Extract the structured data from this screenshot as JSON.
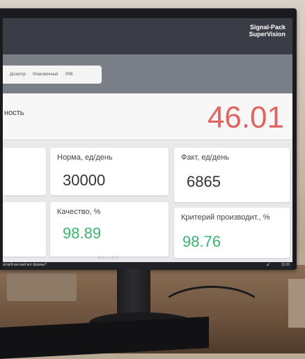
{
  "brand": {
    "line1": "Signal-Pack",
    "line2": "SuperVision"
  },
  "tabs": [
    "Дозатор",
    "Упаковочный",
    "УКВ"
  ],
  "main": {
    "label": "ность",
    "value": "46.01"
  },
  "cards": {
    "norm": {
      "label": "Норма, ед/день",
      "value": "30000"
    },
    "fact": {
      "label": "Факт, ед/день",
      "value": "6865"
    },
    "quality": {
      "label": "Качество, %",
      "value": "98.89"
    },
    "criterion": {
      "label": "Критерий производит., %",
      "value": "98.76"
    }
  },
  "taskbar": {
    "text": "атор/й весный вот формы?",
    "time": "11:03"
  },
  "bezel": {
    "logo": "PHILIPS"
  },
  "colors": {
    "accent_red": "#e0645f",
    "accent_green": "#3cb371",
    "header": "#3a3d44"
  }
}
